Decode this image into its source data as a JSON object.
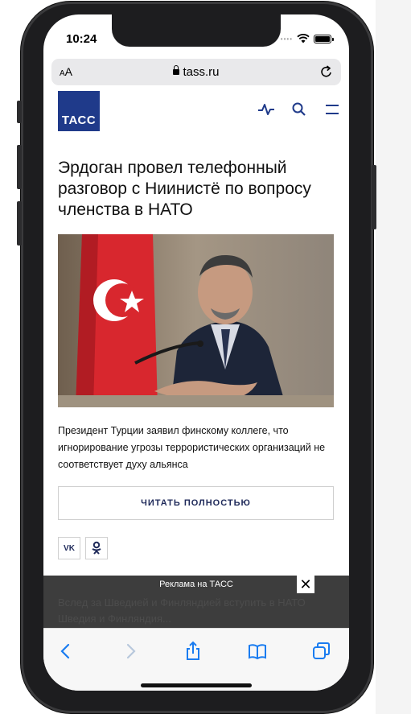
{
  "status": {
    "time": "10:24"
  },
  "browser": {
    "text_size_label": "AA",
    "url": "tass.ru"
  },
  "site": {
    "logo_text": "ТАСС"
  },
  "article": {
    "title": "Эрдоган провел телефонный разговор с Ниинистё по вопросу членства в НАТО",
    "summary": "Президент Турции заявил финскому коллеге, что игнорирование угрозы террористических организаций не соответствует духу альянса",
    "read_more_label": "ЧИТАТЬ ПОЛНОСТЬЮ",
    "share": {
      "vk_label": "VK"
    }
  },
  "ad": {
    "label": "Реклама на ТАСС",
    "close_label": "✕",
    "ghost_line_1": "Вслед за Шведией и Финляндией вступить в НАТО",
    "ghost_line_2": "Шведия и Финляндия..."
  },
  "colors": {
    "brand": "#1f3a8a",
    "flag_red": "#d8272e"
  },
  "icons": [
    "pulse-icon",
    "search-icon",
    "menu-icon",
    "lock-icon",
    "reload-icon",
    "back-icon",
    "forward-icon",
    "share-icon",
    "bookmarks-icon",
    "tabs-icon",
    "close-icon",
    "odnoklassniki-icon"
  ]
}
